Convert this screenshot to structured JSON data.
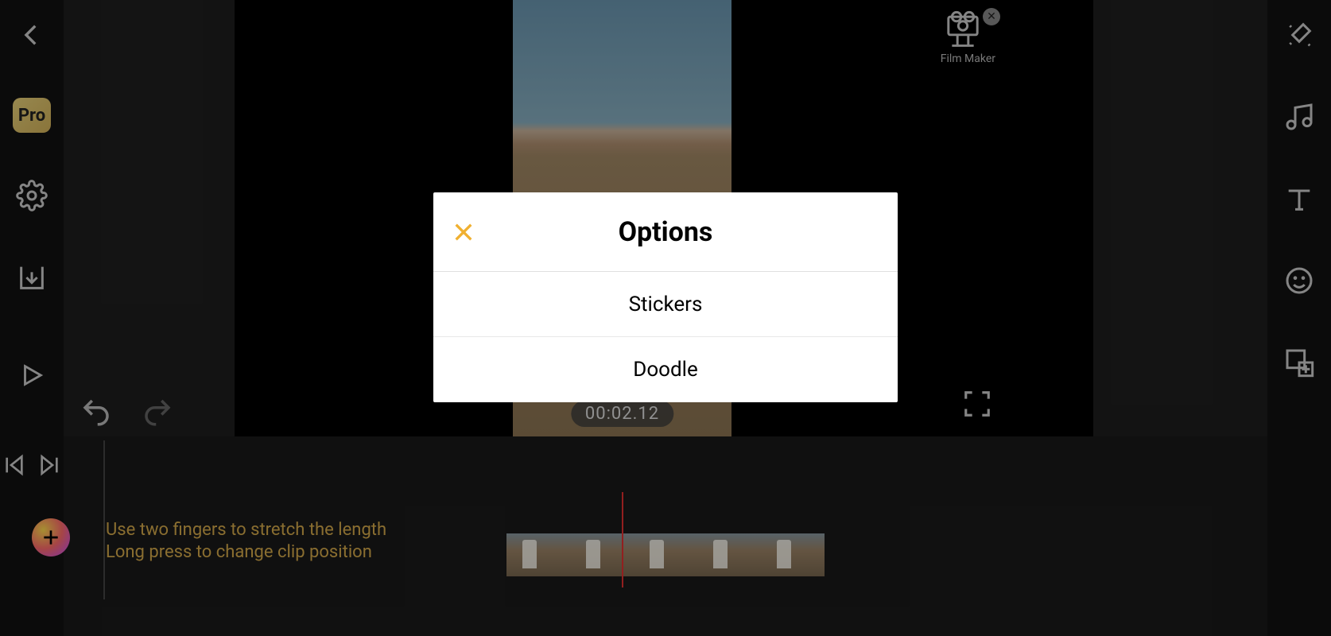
{
  "left_rail": {
    "pro_label": "Pro"
  },
  "preview": {
    "timestamp": "00:02.12",
    "watermark_label": "Film Maker"
  },
  "timeline": {
    "hint_line1": "Use two fingers to stretch the length",
    "hint_line2": "Long press to change clip position"
  },
  "modal": {
    "title": "Options",
    "items": [
      "Stickers",
      "Doodle"
    ]
  }
}
